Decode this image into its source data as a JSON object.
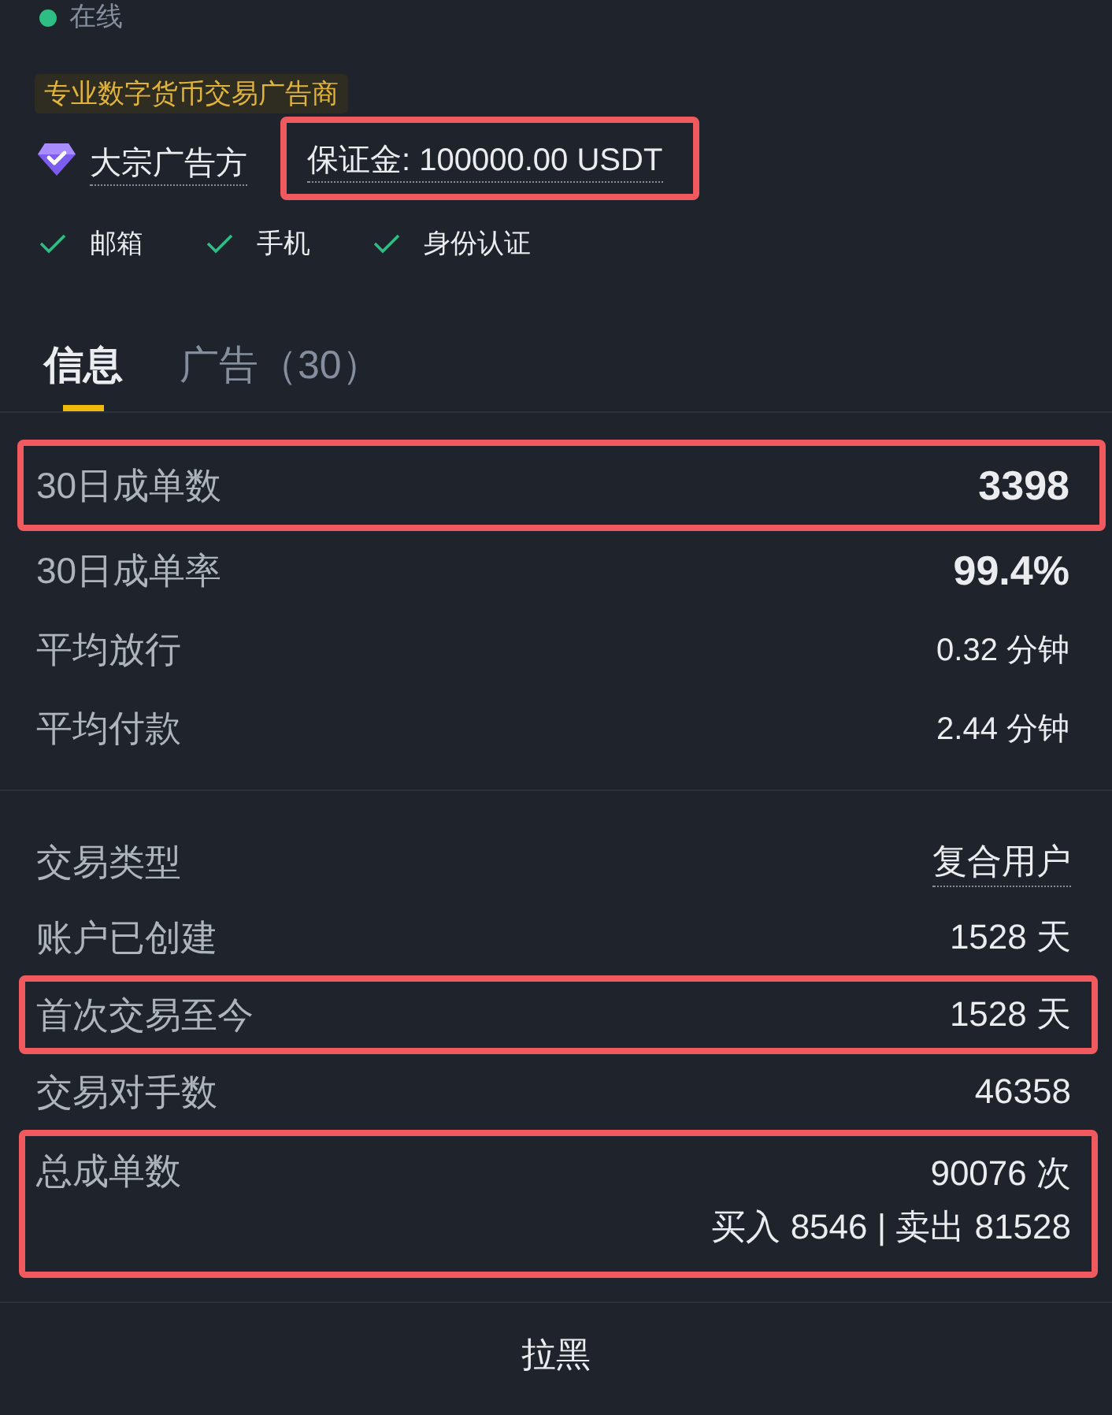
{
  "status": {
    "label": "在线",
    "online": true
  },
  "advertiser_badge": "专业数字货币交易广告商",
  "merchant": {
    "label": "大宗广告方",
    "underlined": true
  },
  "deposit": {
    "text": "保证金: 100000.00 USDT",
    "underlined": true,
    "highlighted": true
  },
  "verifications": [
    {
      "label": "邮箱",
      "verified": true
    },
    {
      "label": "手机",
      "verified": true
    },
    {
      "label": "身份认证",
      "verified": true
    }
  ],
  "tabs": [
    {
      "label": "信息",
      "selected": true
    },
    {
      "label": "广告（30）",
      "selected": false
    }
  ],
  "stats": [
    {
      "label": "30日成单数",
      "value": "3398",
      "emphasized": true,
      "highlighted": true
    },
    {
      "label": "30日成单率",
      "value": "99.4%",
      "emphasized": true,
      "highlighted": false
    },
    {
      "label": "平均放行",
      "value": "0.32 分钟",
      "emphasized": false,
      "highlighted": false
    },
    {
      "label": "平均付款",
      "value": "2.44 分钟",
      "emphasized": false,
      "highlighted": false
    }
  ],
  "details": [
    {
      "label": "交易类型",
      "value": "复合用户",
      "underlined": true,
      "highlighted": false
    },
    {
      "label": "账户已创建",
      "value": "1528 天",
      "underlined": false,
      "highlighted": false
    },
    {
      "label": "首次交易至今",
      "value": "1528 天",
      "underlined": false,
      "highlighted": true
    },
    {
      "label": "交易对手数",
      "value": "46358",
      "underlined": false,
      "highlighted": false
    },
    {
      "label": "总成单数",
      "value": "90076 次",
      "sub_value": "买入 8546 | 卖出 81528",
      "underlined": false,
      "highlighted": true
    }
  ],
  "footer_button": "拉黑"
}
